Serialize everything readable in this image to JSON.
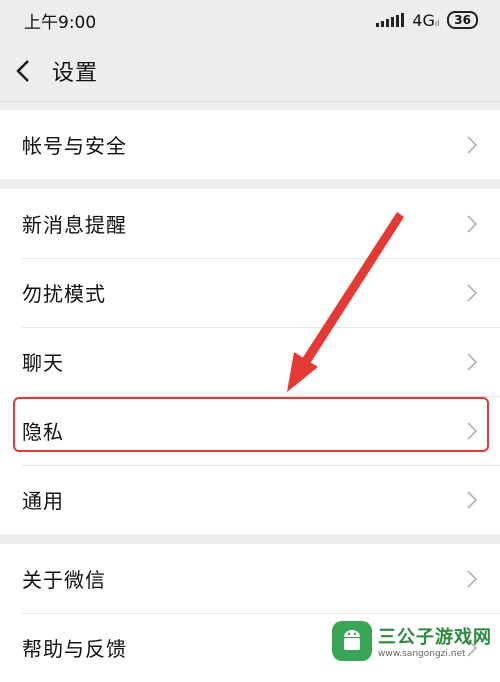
{
  "status_bar": {
    "time": "上午9:00",
    "network": "4G",
    "network_sub": "ıl",
    "battery": "36"
  },
  "nav": {
    "title": "设置"
  },
  "groups": [
    {
      "items": [
        {
          "label": "帐号与安全"
        }
      ]
    },
    {
      "items": [
        {
          "label": "新消息提醒"
        },
        {
          "label": "勿扰模式"
        },
        {
          "label": "聊天"
        },
        {
          "label": "隐私"
        },
        {
          "label": "通用"
        }
      ]
    },
    {
      "items": [
        {
          "label": "关于微信"
        },
        {
          "label": "帮助与反馈"
        }
      ]
    }
  ],
  "annotation": {
    "highlighted_item": "隐私",
    "color": "#e53935"
  },
  "watermark": {
    "name": "三公子游戏网",
    "url": "www.sangongzi.net"
  }
}
